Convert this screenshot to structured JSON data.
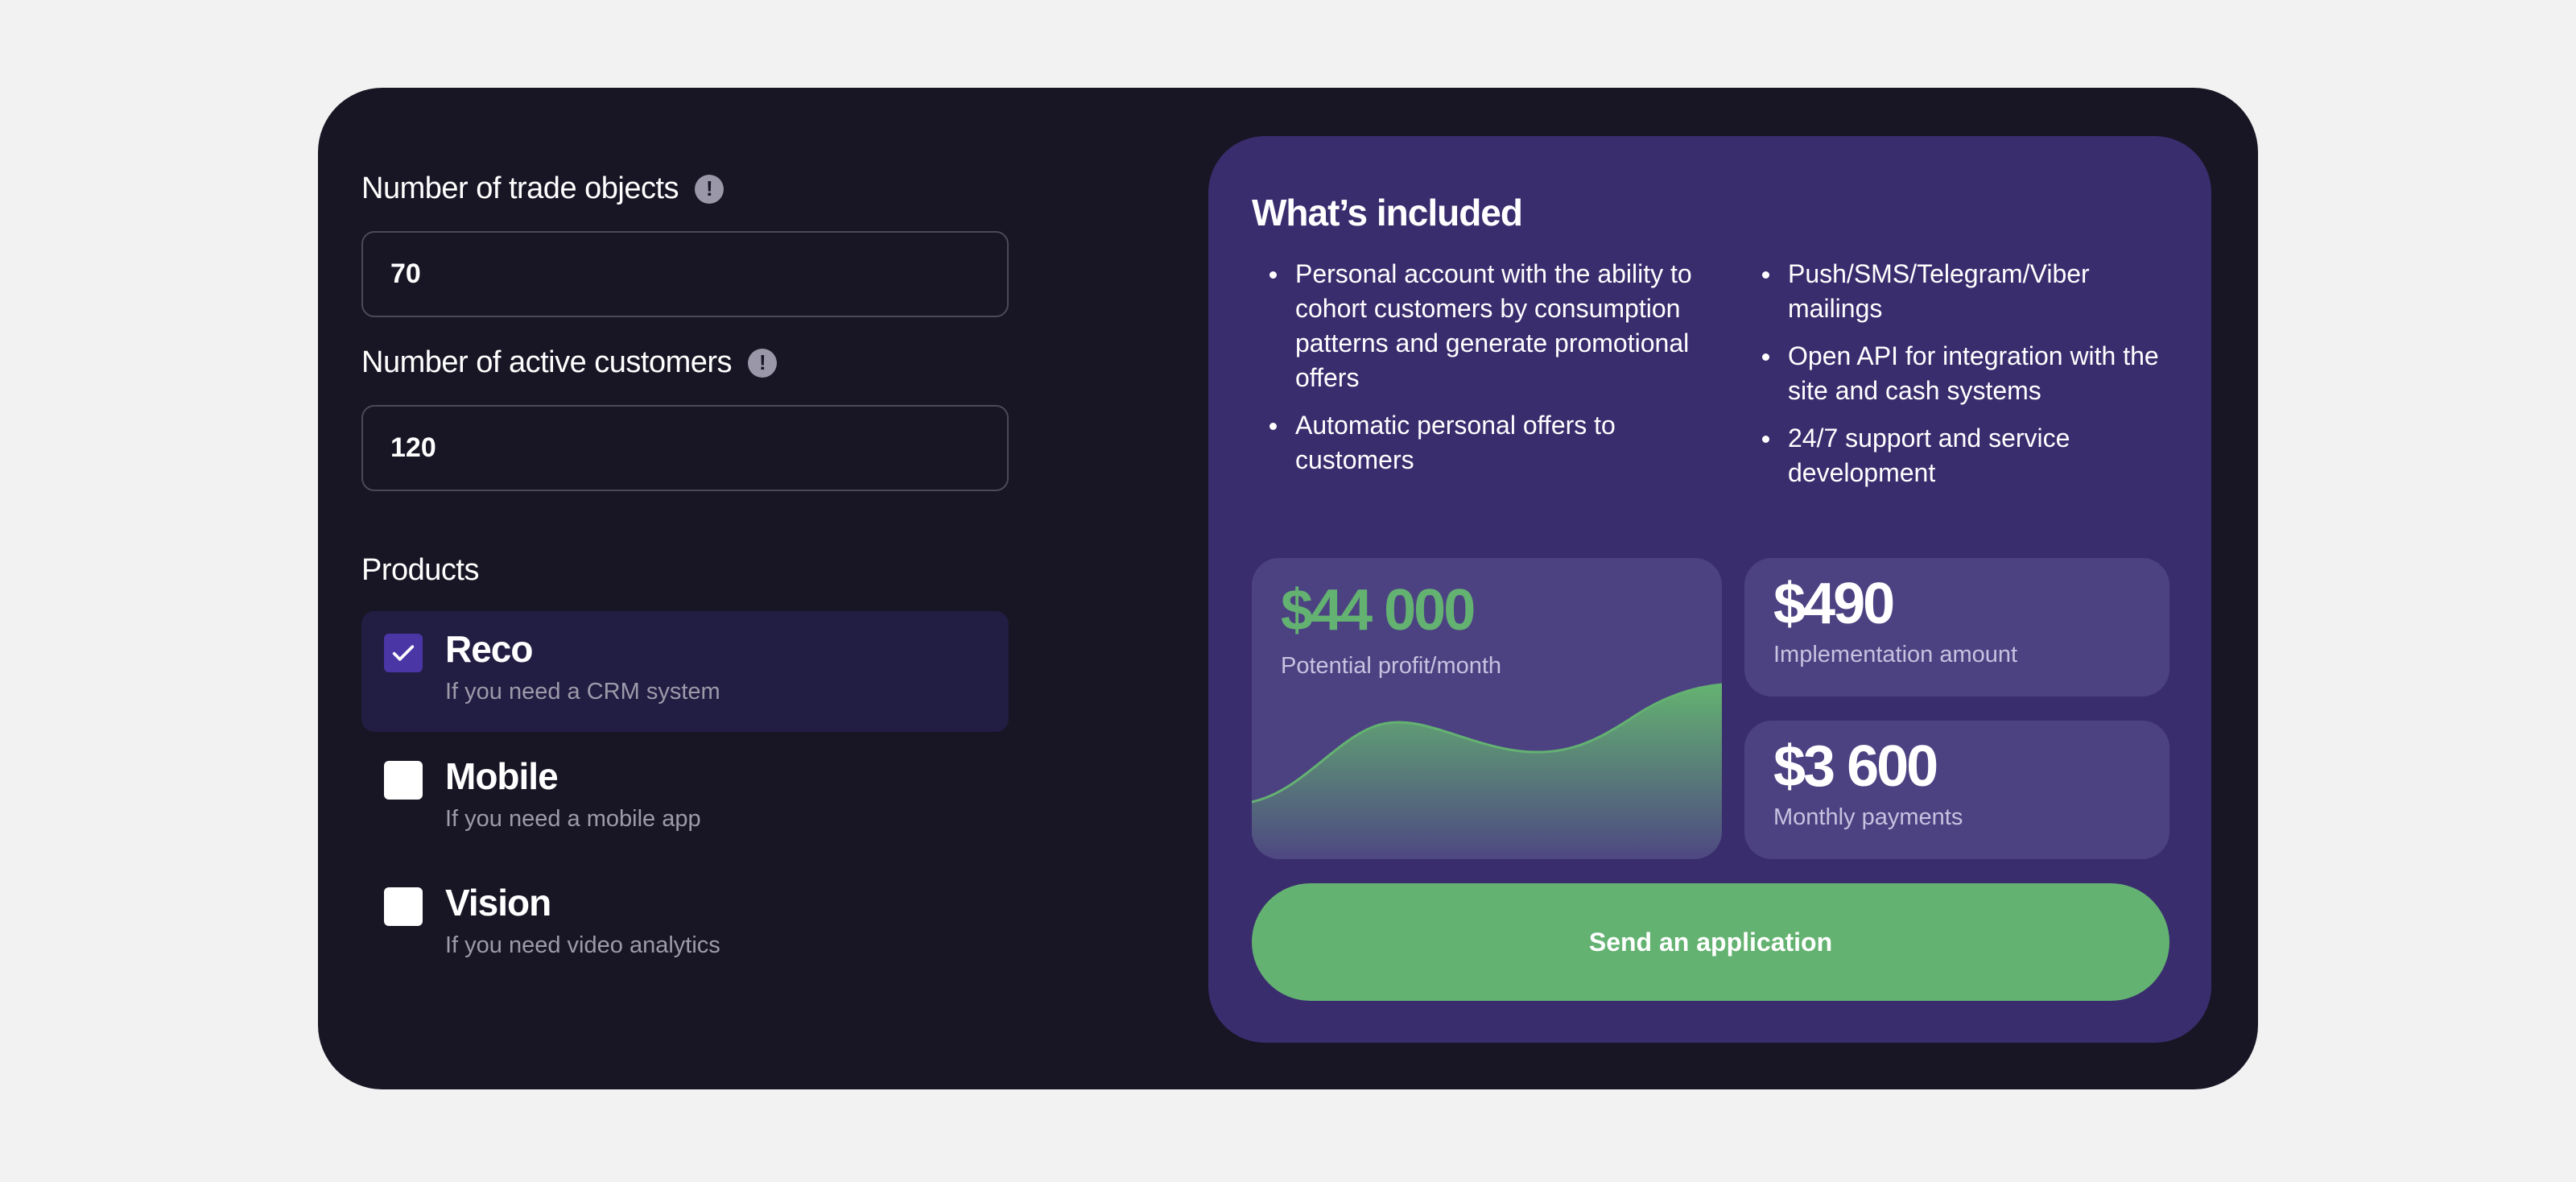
{
  "form": {
    "trade_objects": {
      "label": "Number of trade objects",
      "value": "70"
    },
    "active_customers": {
      "label": "Number of active customers",
      "value": "120"
    },
    "info_icon_glyph": "!"
  },
  "products": {
    "label": "Products",
    "items": [
      {
        "name": "Reco",
        "description": "If you need a CRM system",
        "checked": true
      },
      {
        "name": "Mobile",
        "description": "If you need a mobile app",
        "checked": false
      },
      {
        "name": "Vision",
        "description": "If you need video analytics",
        "checked": false
      }
    ]
  },
  "included": {
    "title": "What’s included",
    "left_items": [
      "Personal account with the ability to cohort customers by consumption patterns and generate promotional offers",
      "Automatic personal offers to customers"
    ],
    "right_items": [
      "Push/SMS/Telegram/Viber mailings",
      "Open API for integration with the site and cash systems",
      "24/7 support and service development"
    ]
  },
  "stats": {
    "profit": {
      "value": "$44 000",
      "label": "Potential profit/month"
    },
    "implementation": {
      "value": "$490",
      "label": "Implementation amount"
    },
    "monthly": {
      "value": "$3 600",
      "label": "Monthly payments"
    }
  },
  "actions": {
    "send_label": "Send an application"
  },
  "colors": {
    "background": "#f2f2f2",
    "card": "#181624",
    "panel": "#3a2d6e",
    "stat_box": "#4c4282",
    "accent_green": "#64b271",
    "checkbox_checked": "#4b36a6"
  }
}
